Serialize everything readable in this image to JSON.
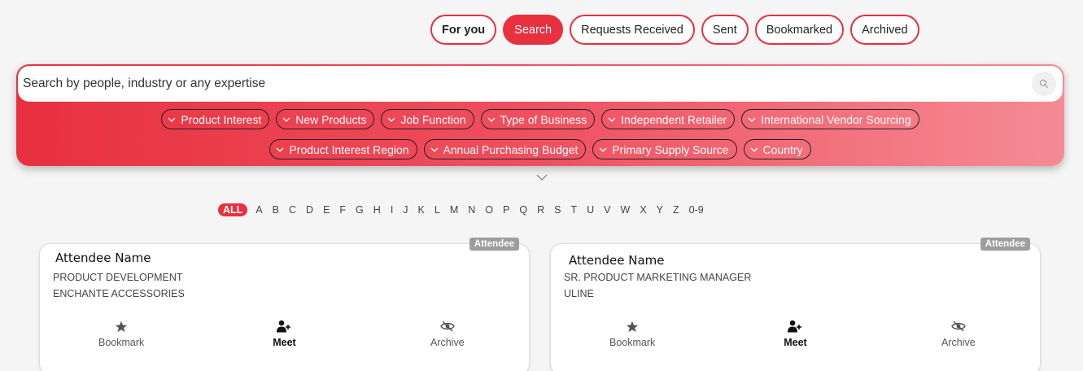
{
  "tabs": [
    {
      "label": "For you"
    },
    {
      "label": "Search"
    },
    {
      "label": "Requests Received"
    },
    {
      "label": "Sent"
    },
    {
      "label": "Bookmarked"
    },
    {
      "label": "Archived"
    }
  ],
  "search": {
    "placeholder": "Search by people, industry or any expertise"
  },
  "filters_row1": [
    {
      "label": "Product Interest"
    },
    {
      "label": "New Products"
    },
    {
      "label": "Job Function"
    },
    {
      "label": "Type of Business"
    },
    {
      "label": "Independent Retailer"
    },
    {
      "label": "International Vendor Sourcing"
    }
  ],
  "filters_row2": [
    {
      "label": "Product Interest Region"
    },
    {
      "label": "Annual Purchasing Budget"
    },
    {
      "label": "Primary Supply Source"
    },
    {
      "label": "Country"
    }
  ],
  "alphabet": [
    "ALL",
    "A",
    "B",
    "C",
    "D",
    "E",
    "F",
    "G",
    "H",
    "I",
    "J",
    "K",
    "L",
    "M",
    "N",
    "O",
    "P",
    "Q",
    "R",
    "S",
    "T",
    "U",
    "V",
    "W",
    "X",
    "Y",
    "Z",
    "0-9"
  ],
  "cards": [
    {
      "badge": "Attendee",
      "name": "Attendee Name",
      "title": "PRODUCT DEVELOPMENT",
      "company": "ENCHANTE ACCESSORIES",
      "actions": {
        "bookmark": "Bookmark",
        "meet": "Meet",
        "archive": "Archive"
      }
    },
    {
      "badge": "Attendee",
      "name": "Attendee Name",
      "title": "SR. PRODUCT MARKETING MANAGER",
      "company": "ULINE",
      "actions": {
        "bookmark": "Bookmark",
        "meet": "Meet",
        "archive": "Archive"
      }
    }
  ],
  "colors": {
    "accent": "#e8303f",
    "badge": "#9e9e9e"
  },
  "icons": {
    "search": "search-icon",
    "chevron": "chevron-down-icon",
    "bookmark": "star-icon",
    "meet": "add-user-icon",
    "archive": "eye-slash-icon"
  }
}
